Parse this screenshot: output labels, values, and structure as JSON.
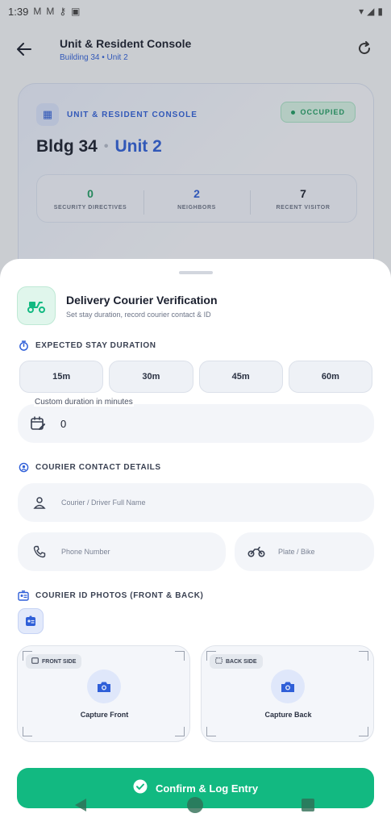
{
  "status_bar": {
    "time": "1:39"
  },
  "app_bar": {
    "title": "Unit & Resident Console",
    "subtitle": "Building 34 • Unit 2"
  },
  "console_card": {
    "label": "UNIT & RESIDENT CONSOLE",
    "status": "OCCUPIED",
    "building": "Bldg 34",
    "separator": "•",
    "unit": "Unit 2",
    "stats": [
      {
        "value": "0",
        "label": "SECURITY DIRECTIVES"
      },
      {
        "value": "2",
        "label": "NEIGHBORS"
      },
      {
        "value": "7",
        "label": "RECENT VISITOR"
      }
    ]
  },
  "sheet": {
    "title": "Delivery Courier Verification",
    "subtitle": "Set stay duration, record courier contact & ID",
    "stay_section": {
      "label": "EXPECTED STAY DURATION",
      "options": [
        "15m",
        "30m",
        "45m",
        "60m"
      ],
      "custom_label": "Custom duration in minutes",
      "custom_value": "0"
    },
    "contact_section": {
      "label": "COURIER CONTACT DETAILS",
      "name_placeholder": "Courier / Driver Full Name",
      "phone_placeholder": "Phone Number",
      "plate_placeholder": "Plate / Bike"
    },
    "photos_section": {
      "label": "COURIER ID PHOTOS (FRONT & BACK)",
      "front": {
        "tag": "FRONT SIDE",
        "action": "Capture Front"
      },
      "back": {
        "tag": "BACK SIDE",
        "action": "Capture Back"
      }
    },
    "confirm_label": "Confirm & Log Entry"
  },
  "colors": {
    "accent_green": "#12b981",
    "accent_blue": "#2f5fd8",
    "occupied_green": "#1f9c62"
  }
}
